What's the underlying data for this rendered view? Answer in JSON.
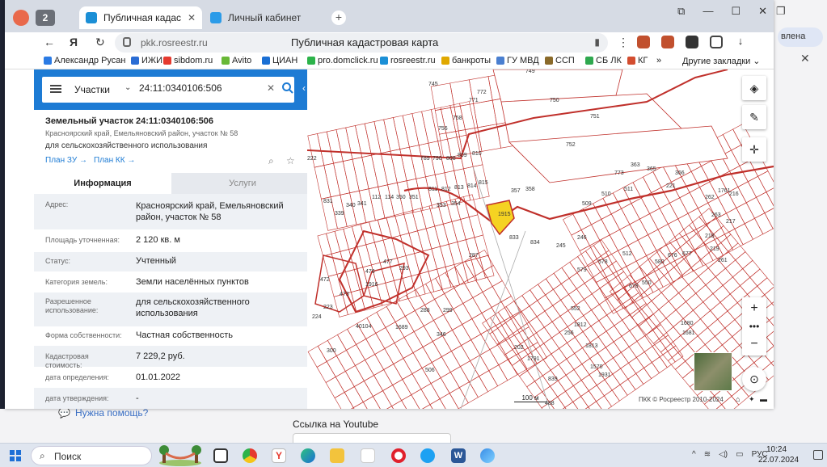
{
  "background": {
    "help_link": "Нужна помощь?",
    "youtube_label": "Ссылка на Youtube",
    "right_button_label": "влена"
  },
  "browser": {
    "tab_count": "2",
    "tabs": [
      {
        "label": "Публичная кадастрова",
        "active": true
      },
      {
        "label": "Личный кабинет",
        "active": false
      }
    ],
    "url_host": "pkk.rosreestr.ru",
    "page_title": "Публичная кадастровая карта",
    "bookmarks": [
      {
        "label": "Александр Русан",
        "color": "#2b7be4"
      },
      {
        "label": "ИЖИ",
        "color": "#2a6cd4"
      },
      {
        "label": "sibdom.ru",
        "color": "#e53a2f"
      },
      {
        "label": "Avito",
        "color": "#69b837"
      },
      {
        "label": "ЦИАН",
        "color": "#1a6fd4"
      },
      {
        "label": "pro.domclick.ru",
        "color": "#2cb34a"
      },
      {
        "label": "rosreestr.ru",
        "color": "#1b8fd6"
      },
      {
        "label": "банкроты",
        "color": "#e0a800"
      },
      {
        "label": "ГУ МВД",
        "color": "#4a7fd0"
      },
      {
        "label": "ССП",
        "color": "#8a6a2a"
      },
      {
        "label": "СБ ЛК",
        "color": "#2fa84f"
      },
      {
        "label": "КГ",
        "color": "#d34d2f"
      }
    ],
    "bookmarks_more": "»",
    "other_bookmarks": "Другие закладки"
  },
  "panel": {
    "search": {
      "type_label": "Участки",
      "query": "24:11:0340106:506"
    },
    "object": {
      "title": "Земельный участок 24:11:0340106:506",
      "address": "Красноярский край, Емельяновский район, участок № 58",
      "use": "для сельскохозяйственного использования",
      "link_plan_zu": "План ЗУ →",
      "link_plan_kk": "План КК →"
    },
    "tabs": {
      "info": "Информация",
      "services": "Услуги"
    },
    "rows": [
      {
        "label": "Адрес:",
        "value": "Красноярский край, Емельяновский район, участок № 58"
      },
      {
        "label": "Площадь уточненная:",
        "value": "2 120 кв. м"
      },
      {
        "label": "Статус:",
        "value": "Учтенный"
      },
      {
        "label": "Категория земель:",
        "value": "Земли населённых пунктов"
      },
      {
        "label": "Разрешенное использование:",
        "value": "для сельскохозяйственного использования"
      },
      {
        "label": "Форма собственности:",
        "value": "Частная собственность"
      },
      {
        "label": "Кадастровая стоимость:",
        "value": "7 229,2 руб."
      },
      {
        "label": "дата определения:",
        "value": "01.01.2022"
      },
      {
        "label": "дата утверждения:",
        "value": "-"
      }
    ]
  },
  "map": {
    "parcel_labels": [
      "745",
      "749",
      "750",
      "751",
      "752",
      "773",
      "363",
      "365",
      "366",
      "771",
      "772",
      "758",
      "756",
      "789",
      "790",
      "808",
      "809",
      "810",
      "811",
      "812",
      "813",
      "814",
      "815",
      "831",
      "339",
      "340",
      "341",
      "112",
      "114",
      "350",
      "351",
      "353",
      "354",
      "357",
      "358",
      "833",
      "834",
      "472",
      "473",
      "476",
      "477",
      "293",
      "287",
      "288",
      "299",
      "300",
      "346",
      "202",
      "256",
      "245",
      "246",
      "509",
      "510",
      "511",
      "512",
      "578",
      "579",
      "580",
      "676",
      "677",
      "678",
      "550",
      "552",
      "1680",
      "1681",
      "1812",
      "1813",
      "1570",
      "1931",
      "1791",
      "839",
      "488",
      "1761",
      "216",
      "217",
      "218",
      "219",
      "261",
      "262",
      "263",
      "221",
      "222",
      "223",
      "224",
      "40104",
      "1915",
      "1916",
      "1689",
      "506"
    ],
    "highlight_label": "506",
    "scale_label": "100 м",
    "copyright": "ПКК © Росреестр 2010-2024",
    "colors": {
      "boundary": "#c0302b",
      "highlight": "#f5d322",
      "panel_blue": "#1d7bd4"
    }
  },
  "taskbar": {
    "search_placeholder": "Поиск",
    "language": "РУС",
    "time": "10:24",
    "date": "22.07.2024"
  }
}
